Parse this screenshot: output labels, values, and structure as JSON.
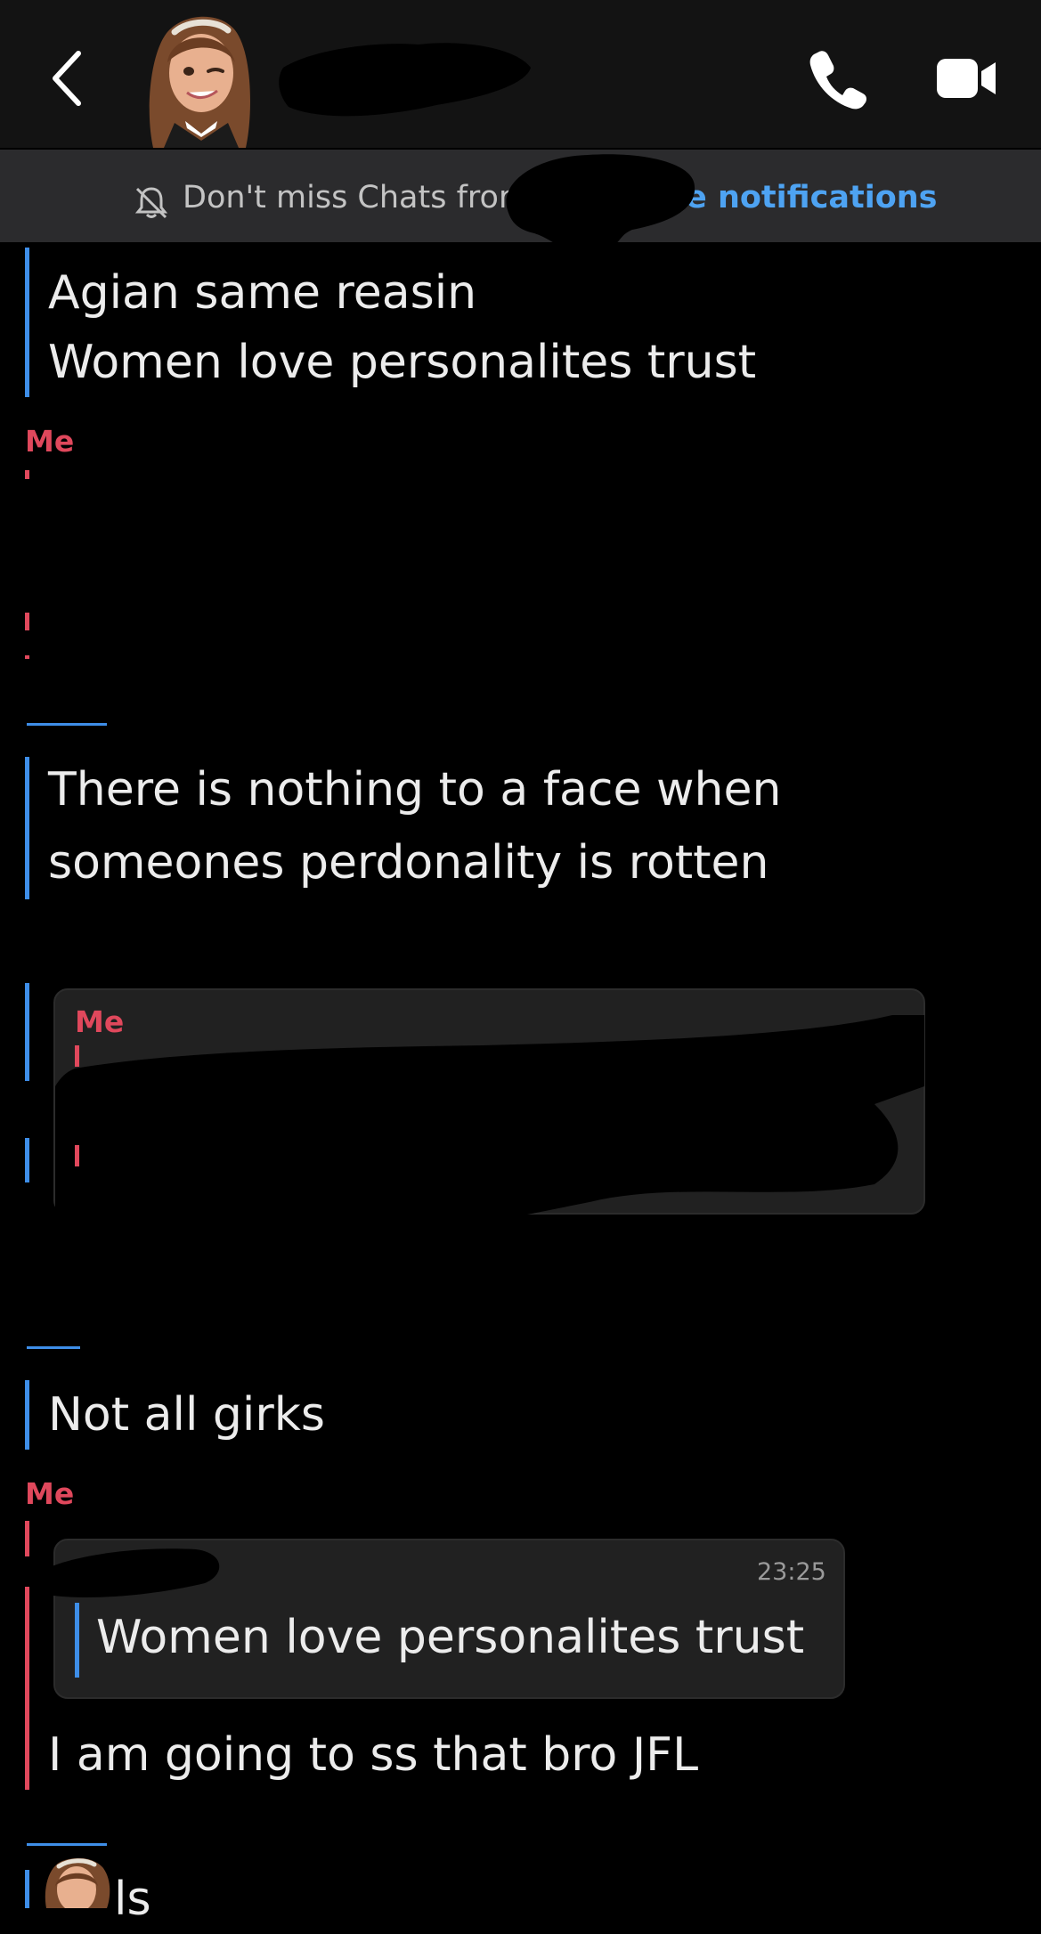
{
  "header": {
    "back_icon": "chevron-left-icon",
    "call_icon": "phone-icon",
    "video_icon": "video-camera-icon"
  },
  "notification": {
    "text": "Don't miss Chats fror",
    "link": "ble notifications",
    "icon": "bell-slash-icon"
  },
  "messages": {
    "m1_line1": "Agian same reasin",
    "m1_line2": "Women love personalites trust",
    "me_label_1": "Me",
    "m2_line1": "There is nothing to a face when",
    "m2_line2": "someones perdonality is rotten",
    "quote_me_label": "Me",
    "m3": "Not all girks",
    "me_label_2": "Me",
    "quote_time": "23:25",
    "quote_text": "Women love personalites trust",
    "m4": "I am going to ss that bro JFL",
    "m5_partial": "ls"
  },
  "colors": {
    "background": "#000000",
    "header": "#131313",
    "banner": "#2b2b2d",
    "accent_blue": "#3e8ee8",
    "accent_red": "#e0485c",
    "link_blue": "#4ea3f2"
  }
}
